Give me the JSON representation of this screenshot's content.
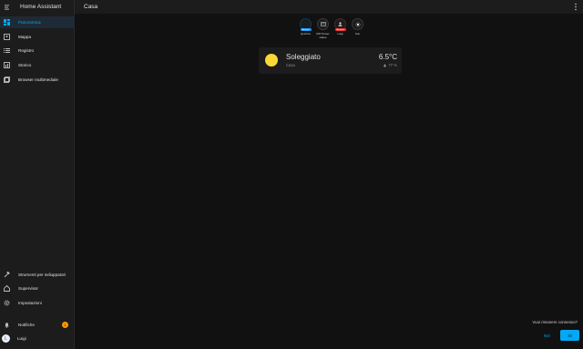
{
  "app": {
    "title": "Home Assistant"
  },
  "header": {
    "title": "Casa"
  },
  "sidebar": {
    "items": [
      {
        "label": "Panoramica",
        "icon": "dashboard-icon"
      },
      {
        "label": "Mappa",
        "icon": "map-icon"
      },
      {
        "label": "Registro",
        "icon": "list-icon"
      },
      {
        "label": "Storico",
        "icon": "chart-icon"
      },
      {
        "label": "Browser multimediale",
        "icon": "media-icon"
      }
    ],
    "bottom_items": [
      {
        "label": "Strumenti per sviluppatori",
        "icon": "hammer-icon"
      },
      {
        "label": "Supervisor",
        "icon": "supervisor-icon"
      },
      {
        "label": "Impostazioni",
        "icon": "gear-icon"
      }
    ],
    "notifications": {
      "label": "Notifiche",
      "count": "1"
    },
    "user": {
      "label": "Luigi",
      "initial": "L"
    }
  },
  "badges": [
    {
      "label": "Quintino",
      "pill": "Assente",
      "color": "#2196f3"
    },
    {
      "label": "RPi Power status",
      "pill": "",
      "color": ""
    },
    {
      "label": "Luigi",
      "pill": "Assente",
      "color": "#e53935"
    },
    {
      "label": "Sun",
      "pill": "",
      "color": ""
    }
  ],
  "weather": {
    "state": "Soleggiato",
    "name": "Casa",
    "temperature": "6.5°C",
    "humidity": "77 %"
  },
  "prompt": {
    "question": "Vuoi rimanere connesso?",
    "no": "NO",
    "yes": "SÌ"
  },
  "colors": {
    "accent": "#03a9f4",
    "sun": "#fdd835",
    "badge": "#ff9800"
  }
}
